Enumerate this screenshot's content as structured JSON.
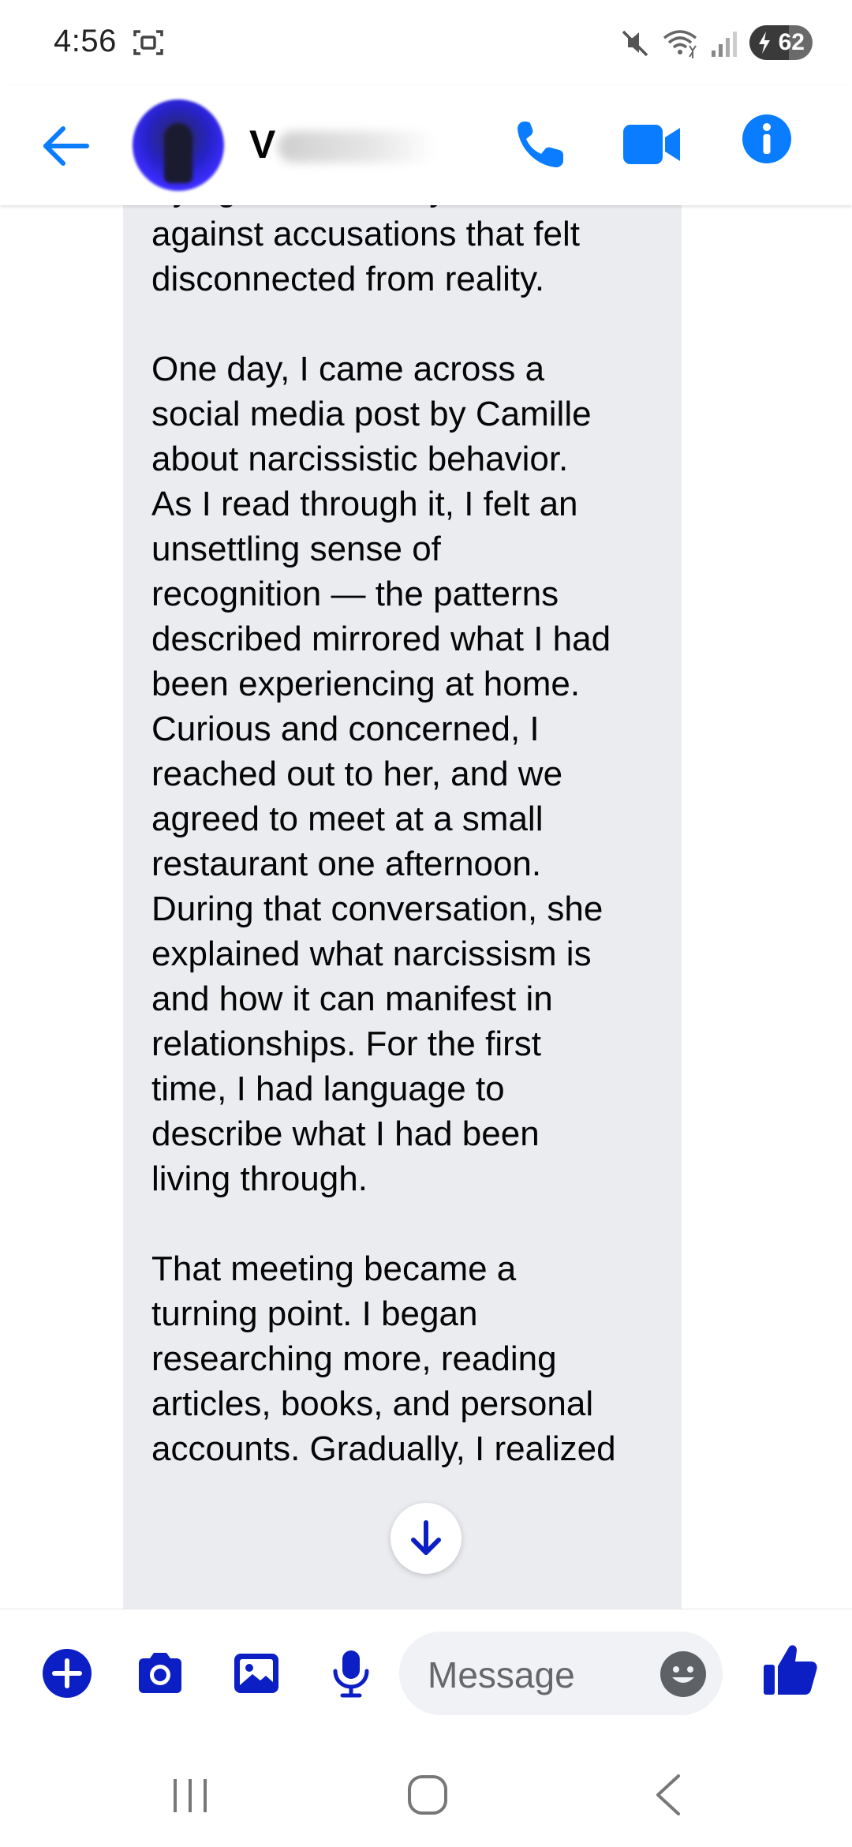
{
  "status_bar": {
    "time": "4:56",
    "battery_level": "62"
  },
  "header": {
    "contact_initial": "V",
    "back_icon": "arrow-left-icon",
    "call_icon": "phone-icon",
    "video_icon": "video-camera-icon",
    "info_icon": "info-icon",
    "accent_color": "#0a7cff"
  },
  "conversation": {
    "message_text": "our relationship slowly\nintensified, and I found\nmyself constantly confused,\ntrying to defend myself\nagainst accusations that felt\ndisconnected from reality.\n\nOne day, I came across a\nsocial media post by Camille\nabout narcissistic behavior.\nAs I read through it, I felt an\nunsettling sense of\nrecognition — the patterns\ndescribed mirrored what I had\nbeen experiencing at home.\nCurious and concerned, I\nreached out to her, and we\nagreed to meet at a small\nrestaurant one afternoon.\nDuring that conversation, she\nexplained what narcissism is\nand how it can manifest in\nrelationships. For the first\ntime, I had language to\ndescribe what I had been\nliving through.\n\nThat meeting became a\nturning point. I began\nresearching more, reading\narticles, books, and personal\naccounts. Gradually, I realized",
    "bubble_color": "#ebecf0",
    "scroll_icon": "arrow-down-icon"
  },
  "composer": {
    "placeholder": "Message",
    "icons": [
      "plus-icon",
      "camera-icon",
      "image-icon",
      "microphone-icon",
      "emoji-icon",
      "thumbs-up-icon"
    ],
    "icon_color": "#0b1fc4"
  },
  "nav_bar": {
    "icons": [
      "recent-apps-icon",
      "home-icon",
      "back-icon"
    ]
  }
}
